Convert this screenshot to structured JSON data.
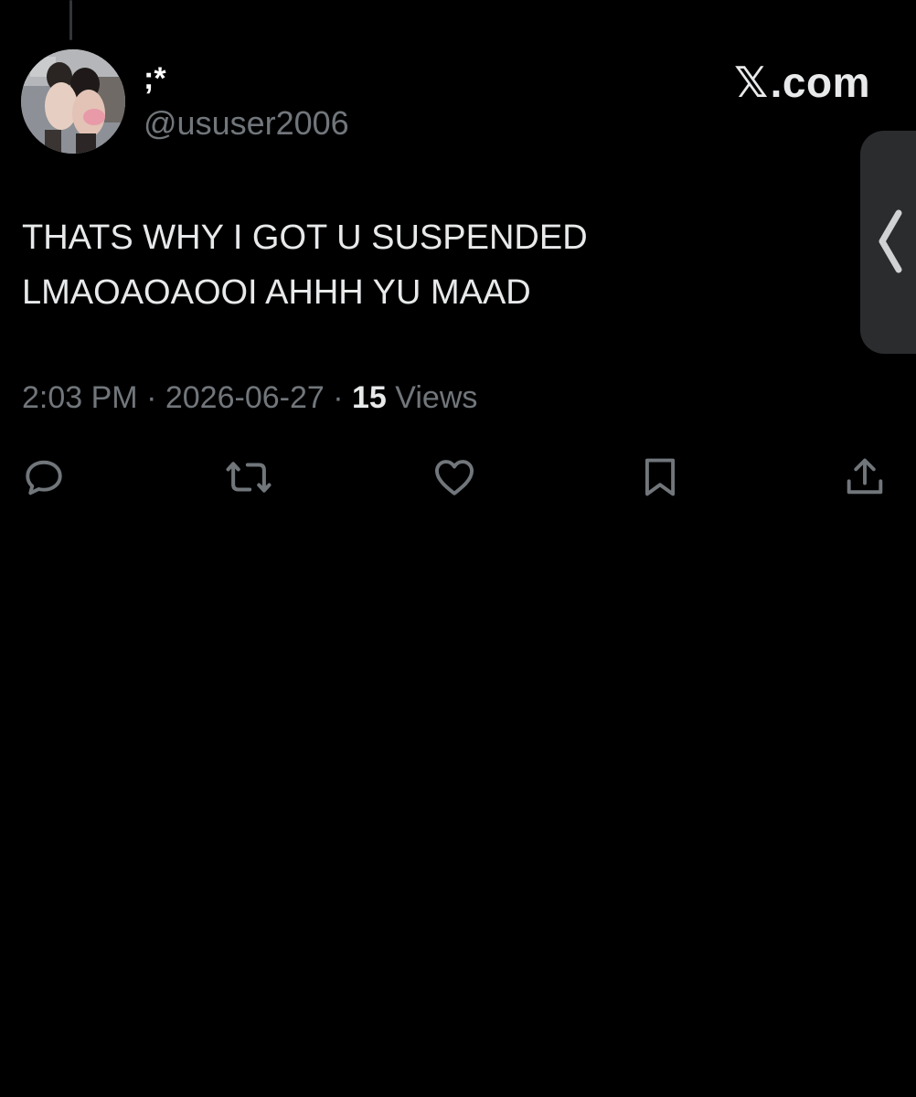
{
  "author": {
    "display_name": ";*",
    "handle": "@ususer2006"
  },
  "brand": {
    "label": ".com",
    "x_glyph": "𝕏",
    "icon": "x-logo-icon"
  },
  "tweet": {
    "text_lines": [
      "THATS WHY I GOT U SUSPENDED",
      "LMAOAOAOOI AHHH YU MAAD"
    ],
    "time": "2:03 PM",
    "separator": "·",
    "date": "2026-06-27",
    "views_count": "15",
    "views_label": "Views"
  },
  "actions": [
    {
      "name": "reply",
      "icon": "reply-icon"
    },
    {
      "name": "retweet",
      "icon": "retweet-icon"
    },
    {
      "name": "like",
      "icon": "heart-icon"
    },
    {
      "name": "bookmark",
      "icon": "bookmark-icon"
    },
    {
      "name": "share",
      "icon": "share-icon"
    }
  ],
  "side_tab": {
    "icon": "chevron-left-icon"
  },
  "colors": {
    "background": "#000000",
    "text_primary": "#e7e9ea",
    "text_secondary": "#71767b",
    "side_tab": "#2b2c2e",
    "thread_line": "#333639"
  }
}
